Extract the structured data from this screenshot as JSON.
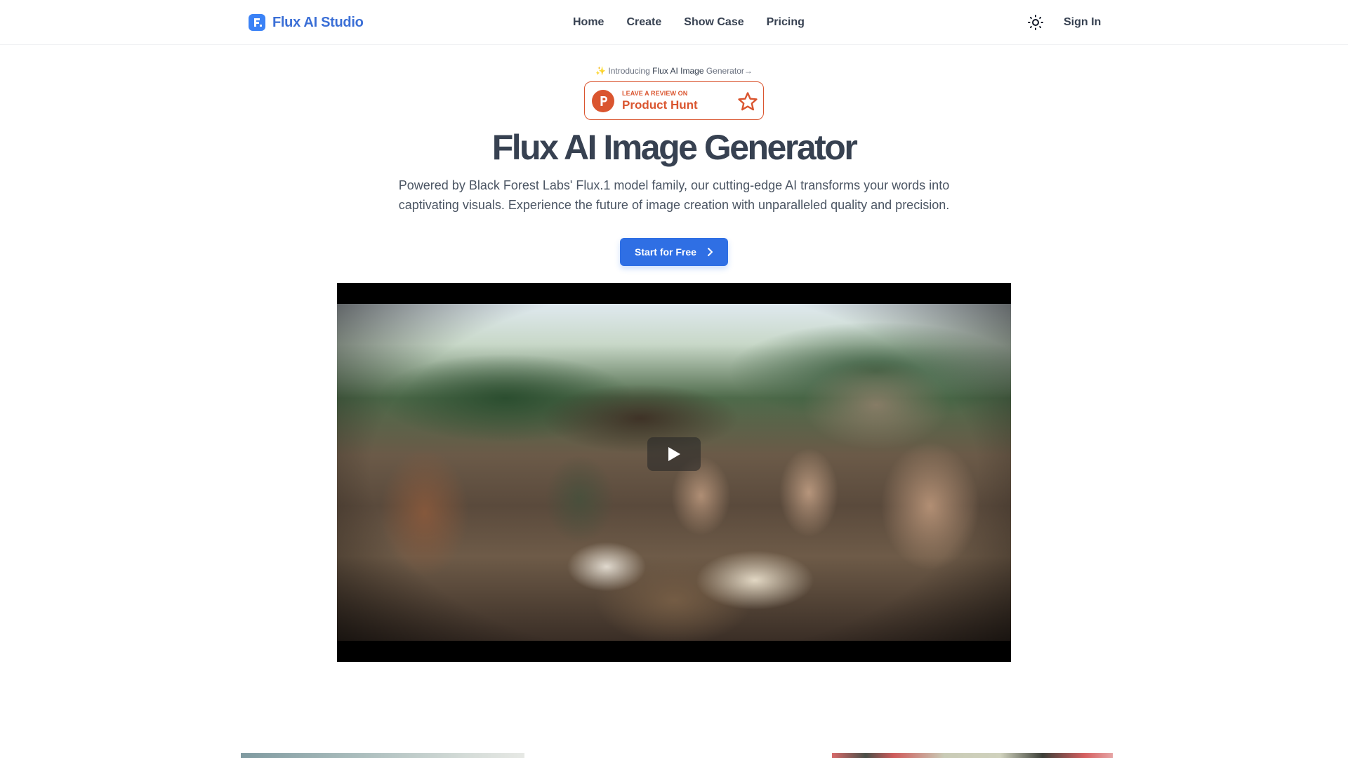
{
  "header": {
    "brand": "Flux AI Studio",
    "brand_icon": "flux-logo-icon",
    "nav": [
      {
        "label": "Home"
      },
      {
        "label": "Create"
      },
      {
        "label": "Show Case"
      },
      {
        "label": "Pricing"
      }
    ],
    "theme_toggle_icon": "sun-icon",
    "signin_label": "Sign In"
  },
  "hero": {
    "intro_prefix": "Introducing ",
    "intro_strong": "Flux AI Image",
    "intro_suffix": " Generator",
    "intro_arrow": "→",
    "intro_icon": "sparkles-icon",
    "product_hunt": {
      "small_label": "LEAVE A REVIEW ON",
      "big_label": "Product Hunt",
      "logo_letter": "P",
      "color": "#da552f"
    },
    "title": "Flux AI Image Generator",
    "subtitle_line1": "Powered by Black Forest Labs' Flux.1 model family, our cutting-edge AI transforms your words into",
    "subtitle_line2": "captivating visuals. Experience the future of image creation with unparalleled quality and precision.",
    "cta_label": "Start for Free",
    "cta_icon": "chevron-right-icon"
  },
  "video": {
    "description": "Group of people toasting with beer and cake at a table in a Black Forest village",
    "play_icon": "play-icon"
  },
  "colors": {
    "brand": "#3b6fd6",
    "cta": "#2f6fe4",
    "text": "#374151"
  }
}
